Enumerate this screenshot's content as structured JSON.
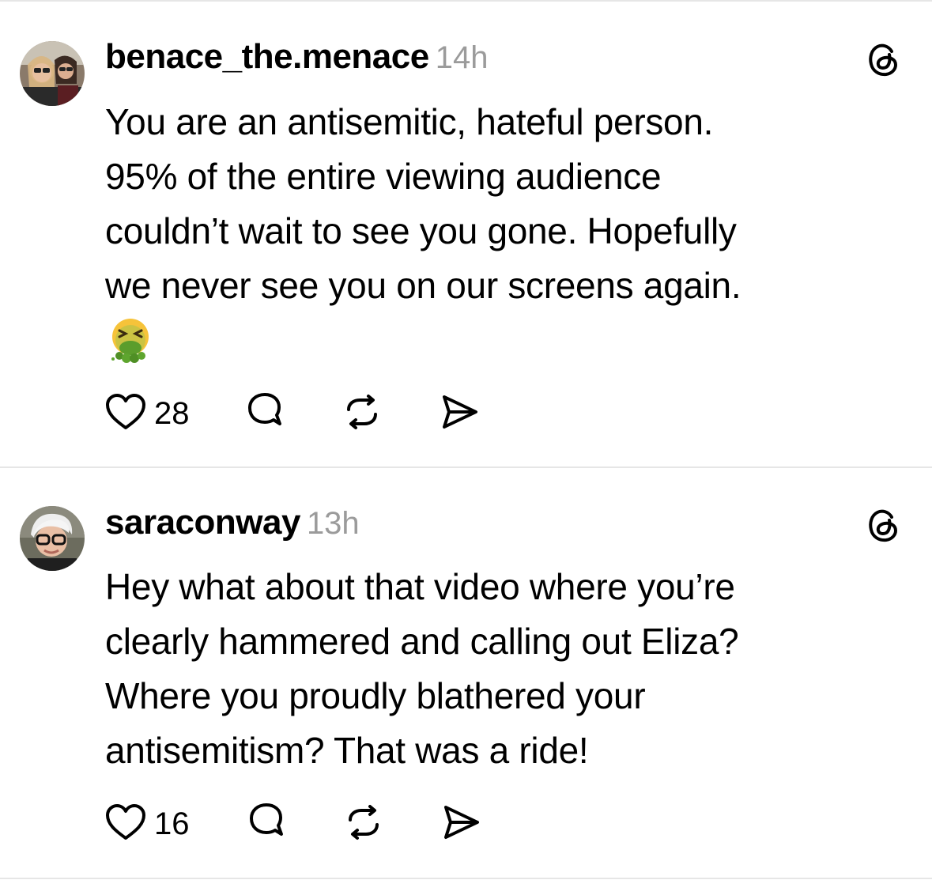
{
  "posts": [
    {
      "username": "benace_the.menace",
      "time": "14h",
      "body": "You are an antisemitic, hateful person.\n95% of the entire viewing audience\ncouldn’t wait to see you gone.  Hopefully\nwe never see you on our screens again.",
      "emoji": "nauseated-vomiting-face",
      "likes": "28"
    },
    {
      "username": "saraconway",
      "time": "13h",
      "body": "Hey what about that video where you’re\nclearly hammered and calling out Eliza?\nWhere you proudly blathered your\nantisemitism?  That was a ride!",
      "likes": "16"
    }
  ],
  "icons": {
    "like": "heart-icon",
    "reply": "comment-icon",
    "repost": "repost-icon",
    "share": "send-icon",
    "brand": "threads-logo-icon"
  }
}
